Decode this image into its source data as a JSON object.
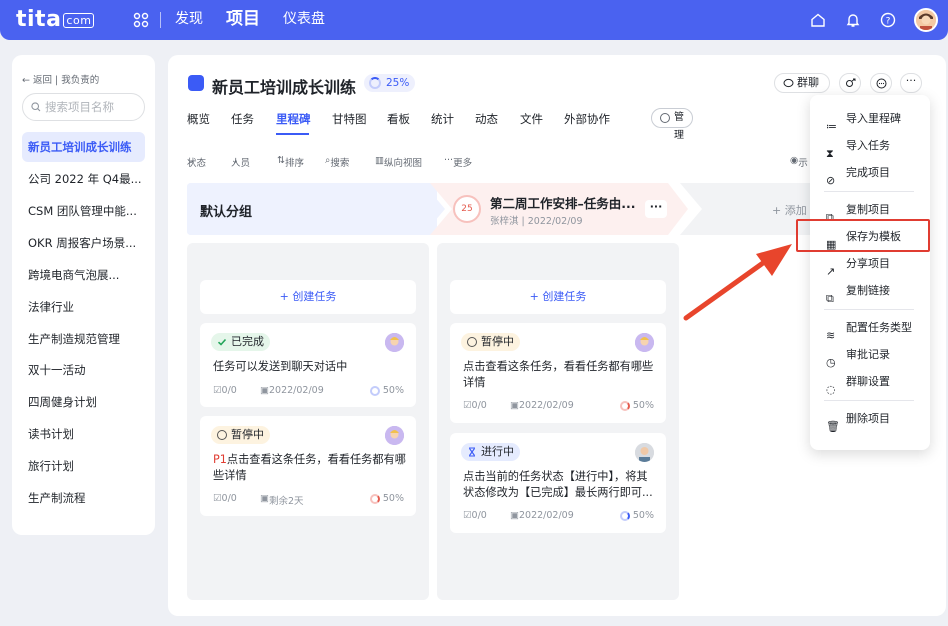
{
  "topbar": {
    "logo": "tita",
    "logo_suffix": "com",
    "nav": [
      "发现",
      "项目",
      "仪表盘"
    ],
    "active_nav": "项目"
  },
  "sidebar": {
    "back": "返回",
    "scope": "我负责的",
    "search_placeholder": "搜索项目名称",
    "items": [
      "新员工培训成长训练",
      "公司 2022 年 Q4最...",
      "CSM 团队管理中能...",
      "OKR 周报客户场景...",
      "跨境电商气泡展...",
      "法律行业",
      "生产制造规范管理",
      "双十一活动",
      "四周健身计划",
      "读书计划",
      "旅行计划",
      "生产制流程"
    ],
    "active_index": 0
  },
  "project": {
    "title": "新员工培训成长训练",
    "progress": "25%",
    "group_chat": "群聊"
  },
  "tabs": [
    "概览",
    "任务",
    "里程碑",
    "甘特图",
    "看板",
    "统计",
    "动态",
    "文件",
    "外部协作"
  ],
  "active_tab": "里程碑",
  "manage": "管理",
  "toolbar": [
    "状态",
    "人员",
    "排序",
    "搜索",
    "纵向视图",
    "更多"
  ],
  "toolbar_right": "示",
  "default_group": "默认分组",
  "milestone": {
    "number": "25",
    "title": "第二周工作安排–任务由...",
    "owner": "张梓淇",
    "date": "2022/02/09",
    "more": "···"
  },
  "add_label": "+ 添加",
  "create_task": "+ 创建任务",
  "columns": [
    {
      "cards": [
        {
          "status": "已完成",
          "kind": "done",
          "text": "任务可以发送到聊天对话中",
          "count": "0/0",
          "date": "2022/02/09",
          "pct": "50%"
        },
        {
          "status": "暂停中",
          "kind": "pause",
          "priority": "P1",
          "text": "点击查看这条任务，看看任务都有哪些详情",
          "count": "0/0",
          "date": "剩余2天",
          "pct": "50%"
        }
      ]
    },
    {
      "cards": [
        {
          "status": "暂停中",
          "kind": "pause",
          "text": "点击查看这条任务，看看任务都有哪些详情",
          "count": "0/0",
          "date": "2022/02/09",
          "pct": "50%"
        },
        {
          "status": "进行中",
          "kind": "prog",
          "text": "点击当前的任务状态【进行中】，将其状态修改为【已完成】最长两行即可...",
          "count": "0/0",
          "date": "2022/02/09",
          "pct": "50%"
        }
      ]
    }
  ],
  "menu": {
    "items": [
      "导入里程碑",
      "导入任务",
      "完成项目",
      "复制项目",
      "保存为模板",
      "分享项目",
      "复制链接",
      "配置任务类型",
      "审批记录",
      "群聊设置",
      "删除项目"
    ],
    "highlighted": "保存为模板"
  },
  "colors": {
    "brand": "#4a62f0",
    "accent": "#3b5bf6",
    "highlight": "#e03c31"
  }
}
